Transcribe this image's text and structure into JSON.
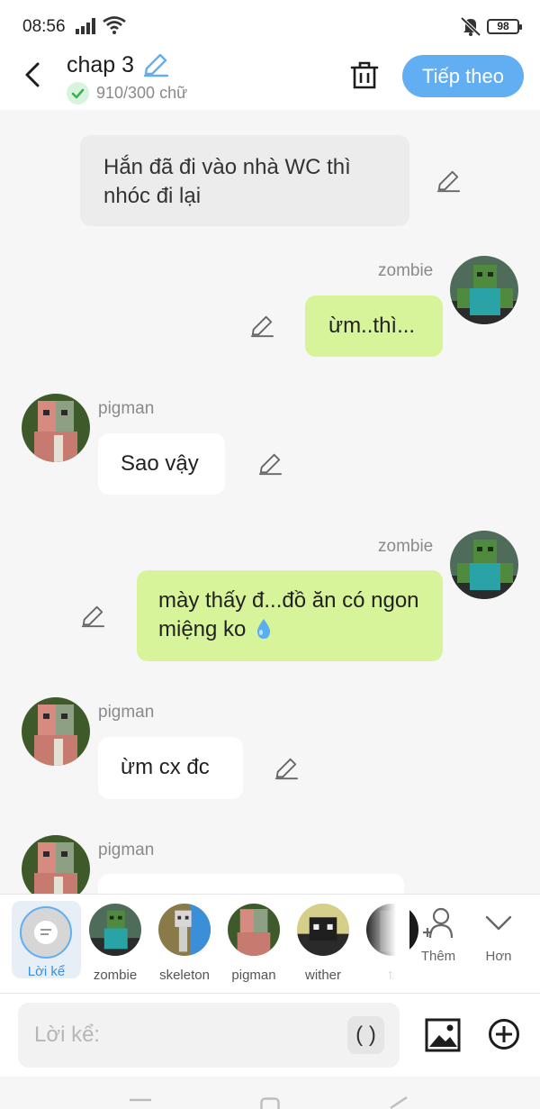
{
  "status_bar": {
    "time": "08:56",
    "battery": "98"
  },
  "header": {
    "title": "chap 3",
    "word_count": "910/300 chữ",
    "next_button": "Tiếp theo"
  },
  "messages": {
    "narration": {
      "text": "Hắn đã đi vào nhà WC thì nhóc đi lại"
    },
    "m1": {
      "sender": "zombie",
      "text": "ừm..thì..."
    },
    "m2": {
      "sender": "pigman",
      "text": "Sao vậy"
    },
    "m3": {
      "sender": "zombie",
      "text": "mày thấy đ...đồ ăn có ngon miệng ko"
    },
    "m4": {
      "sender": "pigman",
      "text": "ừm cx đc"
    },
    "m5": {
      "sender": "pigman",
      "text": ""
    }
  },
  "characters": {
    "narrator_label": "Lời kể",
    "c1": "zombie",
    "c2": "skeleton",
    "c3": "pigman",
    "c4": "wither",
    "c5": "t/",
    "add_label": "Thêm",
    "more_label": "Hơn"
  },
  "input": {
    "placeholder": "Lời kể:",
    "paren_label": "( )"
  },
  "colors": {
    "accent": "#62aef3",
    "bubble_right": "#d7f49a",
    "bubble_left": "#ffffff",
    "narration": "#ececec"
  },
  "icons": [
    "back-icon",
    "pencil-icon",
    "check-icon",
    "trash-icon",
    "add-person-icon",
    "chevron-down-icon",
    "image-icon",
    "plus-circle-icon",
    "water-drop-icon"
  ]
}
